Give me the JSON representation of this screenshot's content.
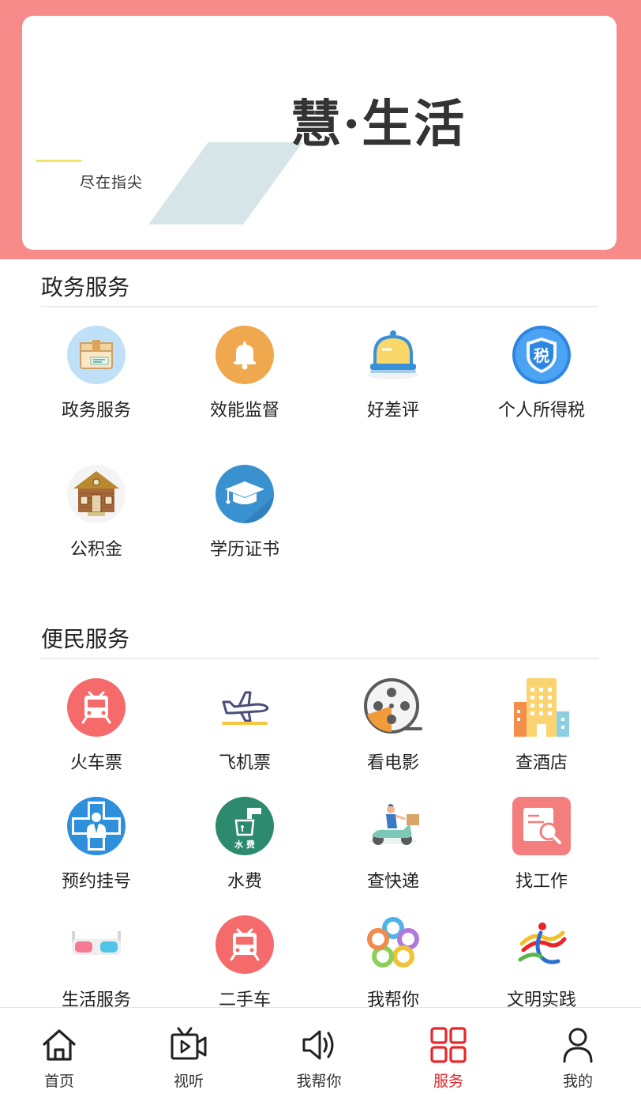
{
  "banner": {
    "title": "慧·生活",
    "slogan": "尽在指尖"
  },
  "gov": {
    "title": "政务服务",
    "items": [
      {
        "label": "政务服务",
        "icon": "package-box-icon"
      },
      {
        "label": "效能监督",
        "icon": "bell-icon"
      },
      {
        "label": "好差评",
        "icon": "desk-bell-icon"
      },
      {
        "label": "个人所得税",
        "icon": "tax-shield-icon",
        "badge": "税"
      },
      {
        "label": "公积金",
        "icon": "house-icon"
      },
      {
        "label": "学历证书",
        "icon": "graduation-cap-icon"
      }
    ]
  },
  "convenience": {
    "title": "便民服务",
    "items": [
      {
        "label": "火车票",
        "icon": "train-icon"
      },
      {
        "label": "飞机票",
        "icon": "airplane-icon"
      },
      {
        "label": "看电影",
        "icon": "film-reel-icon"
      },
      {
        "label": "查酒店",
        "icon": "hotel-icon"
      },
      {
        "label": "预约挂号",
        "icon": "doctor-icon"
      },
      {
        "label": "水费",
        "icon": "water-tap-icon",
        "badge": "水 费"
      },
      {
        "label": "查快递",
        "icon": "delivery-scooter-icon"
      },
      {
        "label": "找工作",
        "icon": "resume-search-icon"
      },
      {
        "label": "生活服务",
        "icon": "3d-glasses-icon"
      },
      {
        "label": "二手车",
        "icon": "bus-icon"
      },
      {
        "label": "我帮你",
        "icon": "flower-ring-icon"
      },
      {
        "label": "文明实践",
        "icon": "ribbon-figure-icon"
      }
    ]
  },
  "tabbar": {
    "items": [
      {
        "label": "首页",
        "icon": "home-icon"
      },
      {
        "label": "视听",
        "icon": "video-icon"
      },
      {
        "label": "我帮你",
        "icon": "speaker-icon"
      },
      {
        "label": "服务",
        "icon": "grid-icon",
        "active": true
      },
      {
        "label": "我的",
        "icon": "user-icon"
      }
    ]
  },
  "colors": {
    "header_bg": "#f78b8a",
    "active_tab": "#e8262a"
  }
}
